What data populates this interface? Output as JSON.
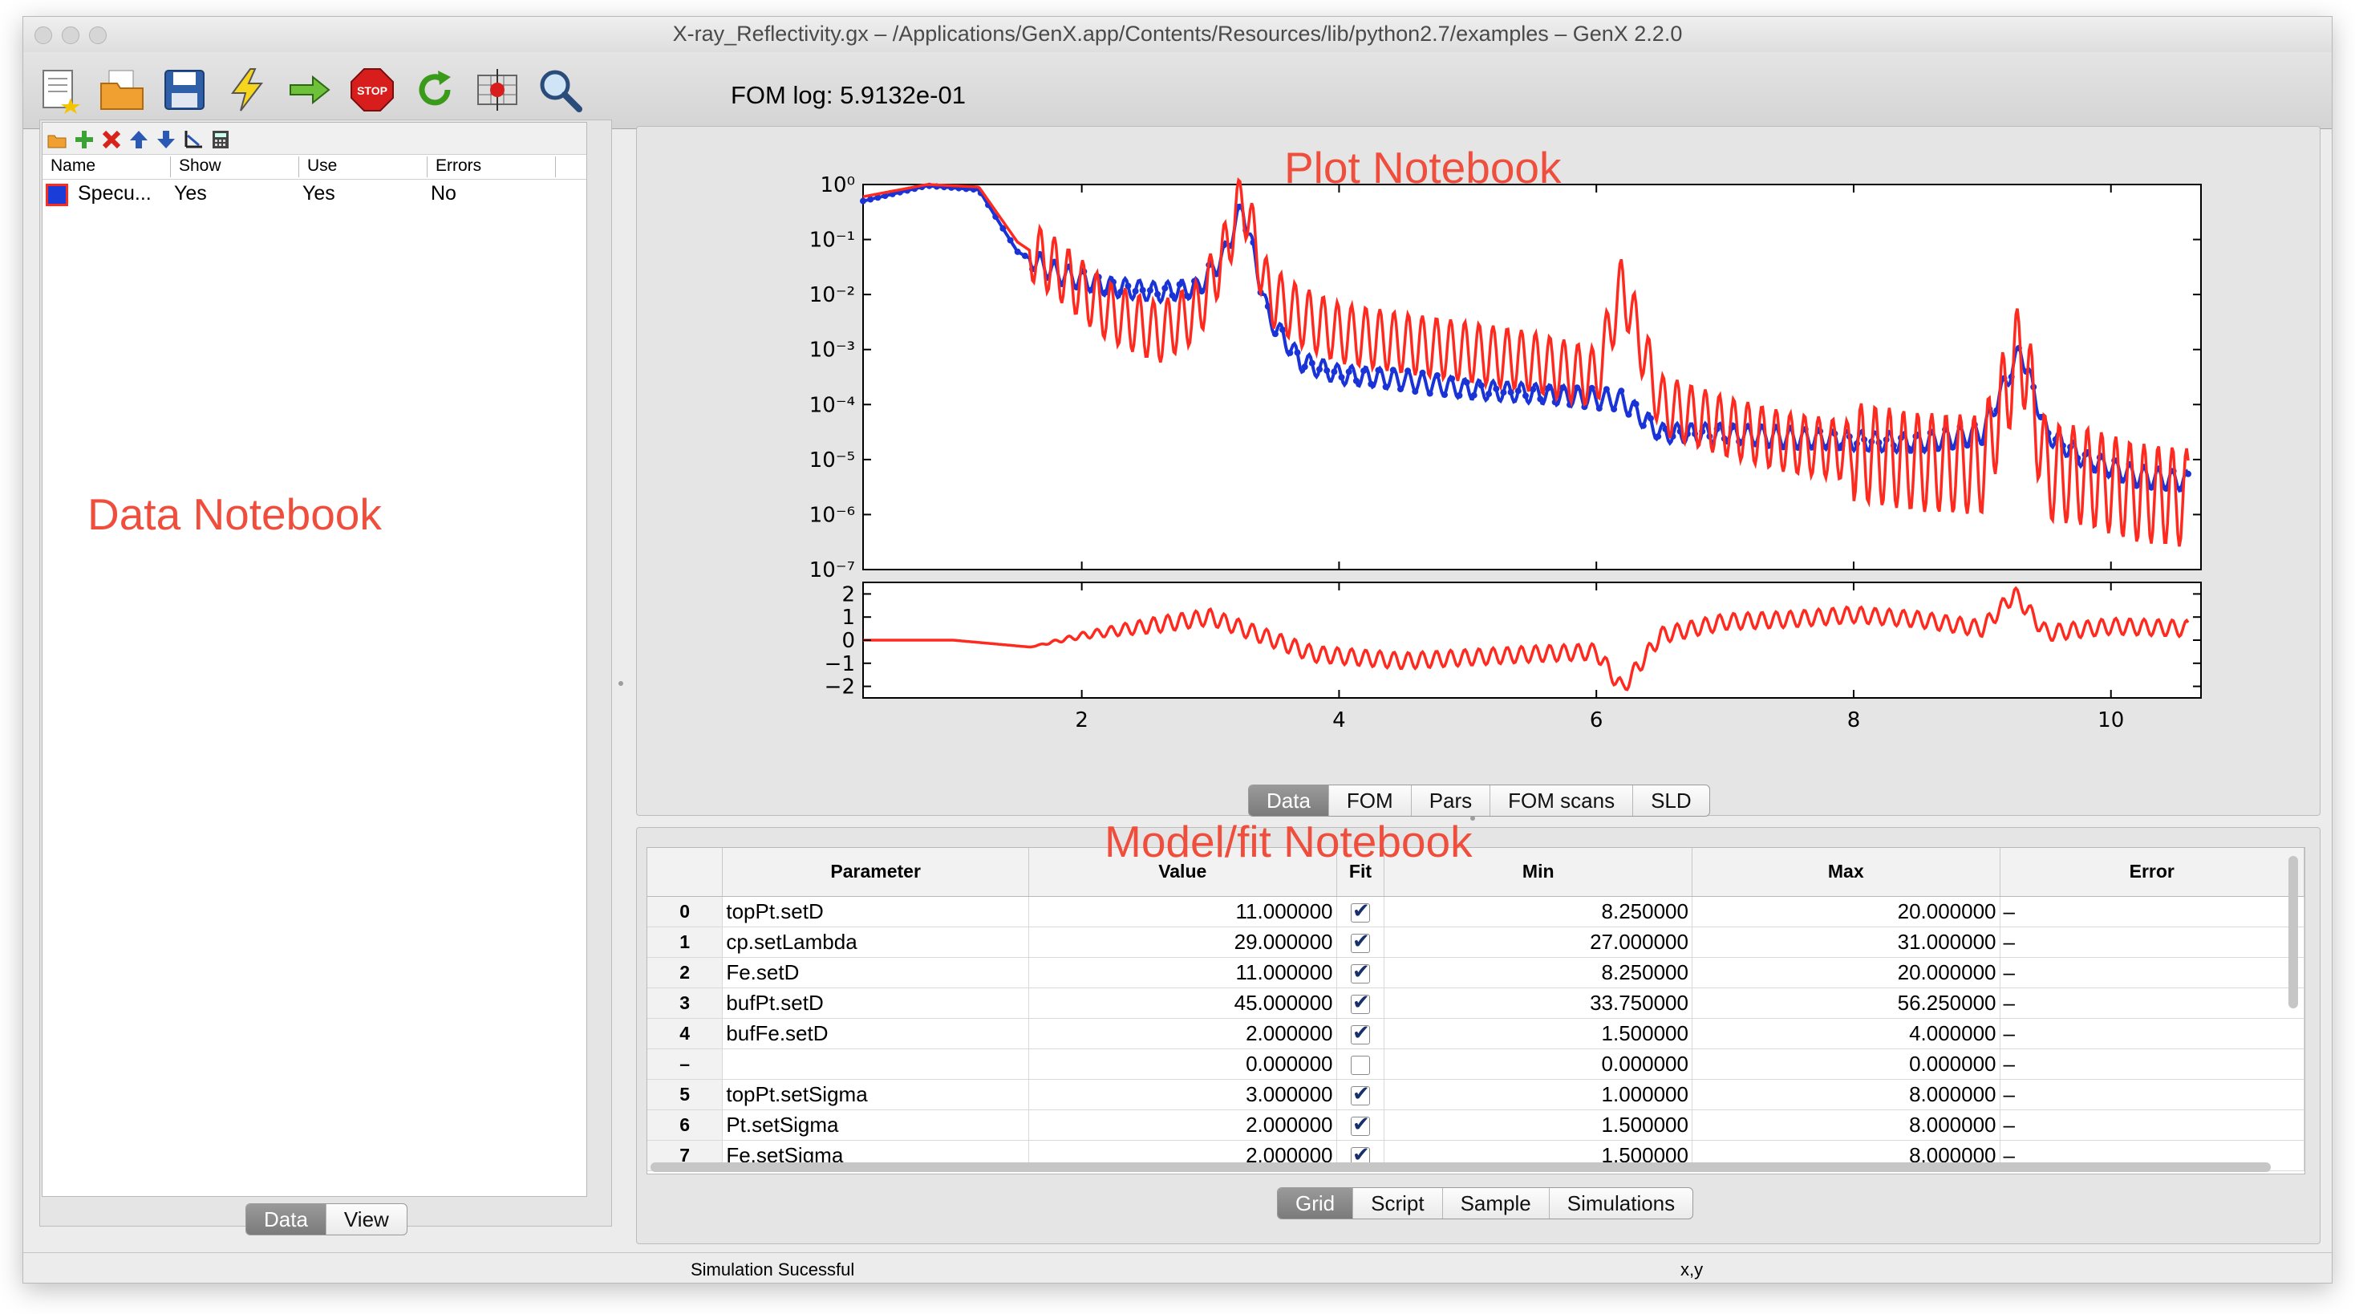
{
  "window": {
    "title": "X-ray_Reflectivity.gx – /Applications/GenX.app/Contents/Resources/lib/python2.7/examples – GenX 2.2.0"
  },
  "toolbar": {
    "icons": [
      "new-file-icon",
      "open-folder-icon",
      "save-disk-icon",
      "simulate-lightning-icon",
      "start-fit-arrow-icon",
      "stop-icon",
      "restart-fit-icon",
      "calculate-errors-icon",
      "zoom-icon"
    ],
    "fom_log": "FOM log: 5.9132e-01"
  },
  "data_notebook": {
    "columns": [
      "Name",
      "Show",
      "Use",
      "Errors"
    ],
    "rows": [
      {
        "name": "Specu...",
        "show": "Yes",
        "use": "Yes",
        "errors": "No",
        "color": "#1a3cd9"
      }
    ],
    "tabs": [
      "Data",
      "View"
    ],
    "active_tab": "Data"
  },
  "plot_notebook": {
    "tabs": [
      "Data",
      "FOM",
      "Pars",
      "FOM scans",
      "SLD"
    ],
    "active_tab": "Data"
  },
  "model_notebook": {
    "columns": [
      "",
      "Parameter",
      "Value",
      "Fit",
      "Min",
      "Max",
      "Error"
    ],
    "rows": [
      {
        "idx": "0",
        "parameter": "topPt.setD",
        "value": "11.000000",
        "fit": true,
        "min": "8.250000",
        "max": "20.000000",
        "error": "–"
      },
      {
        "idx": "1",
        "parameter": "cp.setLambda",
        "value": "29.000000",
        "fit": true,
        "min": "27.000000",
        "max": "31.000000",
        "error": "–"
      },
      {
        "idx": "2",
        "parameter": "Fe.setD",
        "value": "11.000000",
        "fit": true,
        "min": "8.250000",
        "max": "20.000000",
        "error": "–"
      },
      {
        "idx": "3",
        "parameter": "bufPt.setD",
        "value": "45.000000",
        "fit": true,
        "min": "33.750000",
        "max": "56.250000",
        "error": "–"
      },
      {
        "idx": "4",
        "parameter": "bufFe.setD",
        "value": "2.000000",
        "fit": true,
        "min": "1.500000",
        "max": "4.000000",
        "error": "–"
      },
      {
        "idx": "–",
        "parameter": "",
        "value": "0.000000",
        "fit": false,
        "min": "0.000000",
        "max": "0.000000",
        "error": "–"
      },
      {
        "idx": "5",
        "parameter": "topPt.setSigma",
        "value": "3.000000",
        "fit": true,
        "min": "1.000000",
        "max": "8.000000",
        "error": "–"
      },
      {
        "idx": "6",
        "parameter": "Pt.setSigma",
        "value": "2.000000",
        "fit": true,
        "min": "1.500000",
        "max": "8.000000",
        "error": "–"
      },
      {
        "idx": "7",
        "parameter": "Fe.setSigma",
        "value": "2.000000",
        "fit": true,
        "min": "1.500000",
        "max": "8.000000",
        "error": "–"
      }
    ],
    "tabs": [
      "Grid",
      "Script",
      "Sample",
      "Simulations"
    ],
    "active_tab": "Grid"
  },
  "annotations": {
    "plot": "Plot Notebook",
    "data": "Data Notebook",
    "model": "Model/fit Notebook"
  },
  "status": {
    "message": "Simulation Sucessful",
    "coords": "x,y"
  },
  "chart_data": {
    "type": "line",
    "upper": {
      "yscale": "log",
      "ylim": [
        1e-07,
        1
      ],
      "yticks": [
        "10⁰",
        "10⁻¹",
        "10⁻²",
        "10⁻³",
        "10⁻⁴",
        "10⁻⁵",
        "10⁻⁶",
        "10⁻⁷"
      ],
      "series": [
        {
          "color": "#1a33d6",
          "style": "line+markers",
          "x": [
            0.3,
            0.8,
            1.2,
            1.5,
            1.8,
            2.2,
            2.6,
            2.9,
            3.1,
            3.25,
            3.45,
            3.7,
            4.0,
            4.5,
            5.0,
            5.5,
            6.0,
            6.2,
            6.5,
            7.0,
            7.5,
            8.0,
            8.5,
            9.0,
            9.3,
            9.5,
            9.8,
            10.2,
            10.6
          ],
          "y": [
            0.5,
            0.95,
            0.8,
            0.06,
            0.025,
            0.014,
            0.011,
            0.013,
            0.05,
            0.4,
            0.004,
            0.0006,
            0.00035,
            0.00028,
            0.00019,
            0.00016,
            0.00013,
            0.00012,
            3e-05,
            3e-05,
            2.5e-05,
            2.2e-05,
            2e-05,
            3e-05,
            0.001,
            3e-05,
            1e-05,
            5e-06,
            4e-06
          ]
        },
        {
          "color": "#ff2a1f",
          "style": "line",
          "x": [
            0.3,
            0.8,
            1.2,
            1.5,
            1.8,
            2.2,
            2.6,
            2.9,
            3.1,
            3.25,
            3.45,
            3.7,
            4.0,
            4.5,
            5.0,
            5.5,
            6.0,
            6.2,
            6.5,
            7.0,
            7.5,
            8.0,
            8.5,
            9.0,
            9.3,
            9.5,
            9.8,
            10.2,
            10.6
          ],
          "y": [
            0.6,
            1.0,
            0.9,
            0.09,
            0.03,
            0.005,
            0.002,
            0.005,
            0.05,
            0.6,
            0.01,
            0.004,
            0.002,
            0.0013,
            0.0009,
            0.0006,
            0.0003,
            0.015,
            0.0001,
            4e-05,
            2e-05,
            1.4e-05,
            9e-06,
            8e-06,
            0.0012,
            6e-06,
            5e-06,
            2.5e-06,
            2e-06
          ]
        }
      ]
    },
    "lower": {
      "ylim": [
        -2.5,
        2.5
      ],
      "yticks": [
        "2",
        "1",
        "0",
        "−1",
        "−2"
      ],
      "xlim": [
        0.3,
        10.7
      ],
      "xticks": [
        "2",
        "4",
        "6",
        "8",
        "10"
      ],
      "color": "#ff2a1f",
      "x": [
        0.3,
        1.0,
        1.6,
        2.0,
        2.5,
        3.0,
        3.3,
        3.8,
        4.5,
        5.5,
        6.0,
        6.2,
        6.5,
        7.0,
        7.5,
        8.0,
        8.5,
        9.0,
        9.25,
        9.5,
        10.0,
        10.6
      ],
      "y": [
        0.0,
        0.0,
        -0.3,
        0.2,
        0.6,
        1.0,
        0.4,
        -0.6,
        -0.9,
        -0.6,
        -0.5,
        -2.1,
        0.2,
        0.8,
        0.9,
        1.1,
        0.9,
        0.5,
        2.0,
        0.3,
        0.6,
        0.5
      ]
    }
  }
}
